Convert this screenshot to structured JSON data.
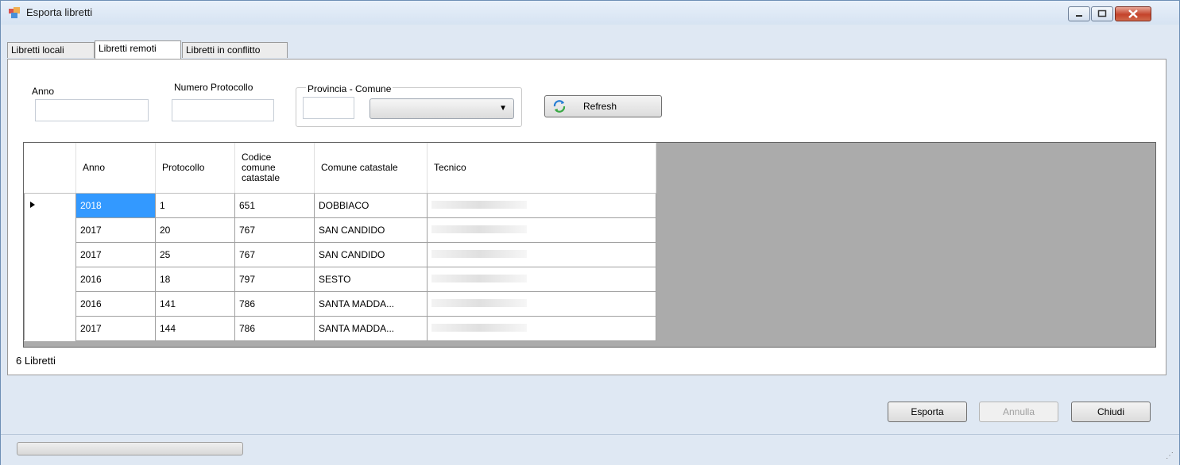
{
  "window": {
    "title": "Esporta libretti",
    "icon": "window-app-icon"
  },
  "tabs": [
    {
      "label": "Libretti locali",
      "active": false
    },
    {
      "label": "Libretti remoti",
      "active": true
    },
    {
      "label": "Libretti in conflitto",
      "active": false
    }
  ],
  "filters": {
    "anno_label": "Anno",
    "anno_value": "",
    "protocollo_label": "Numero Protocollo",
    "protocollo_value": "",
    "provincia_group_label": "Provincia - Comune",
    "provincia_value": "",
    "comune_value": "",
    "refresh_label": "Refresh"
  },
  "grid": {
    "columns": [
      "Anno",
      "Protocollo",
      "Codice comune catastale",
      "Comune catastale",
      "Tecnico"
    ],
    "rows": [
      {
        "anno": "2018",
        "protocollo": "1",
        "codice": "651",
        "comune": "DOBBIACO",
        "tecnico": "",
        "current": true
      },
      {
        "anno": "2017",
        "protocollo": "20",
        "codice": "767",
        "comune": "SAN CANDIDO",
        "tecnico": ""
      },
      {
        "anno": "2017",
        "protocollo": "25",
        "codice": "767",
        "comune": "SAN CANDIDO",
        "tecnico": ""
      },
      {
        "anno": "2016",
        "protocollo": "18",
        "codice": "797",
        "comune": "SESTO",
        "tecnico": ""
      },
      {
        "anno": "2016",
        "protocollo": "141",
        "codice": "786",
        "comune": "SANTA MADDA...",
        "tecnico": ""
      },
      {
        "anno": "2017",
        "protocollo": "144",
        "codice": "786",
        "comune": "SANTA MADDA...",
        "tecnico": ""
      }
    ]
  },
  "status": {
    "count_text": "6 Libretti"
  },
  "footer": {
    "esporta": "Esporta",
    "annulla": "Annulla",
    "chiudi": "Chiudi"
  },
  "colors": {
    "selection": "#3399ff",
    "grid_background": "#ababab",
    "window_chrome": "#dfe8f3"
  }
}
